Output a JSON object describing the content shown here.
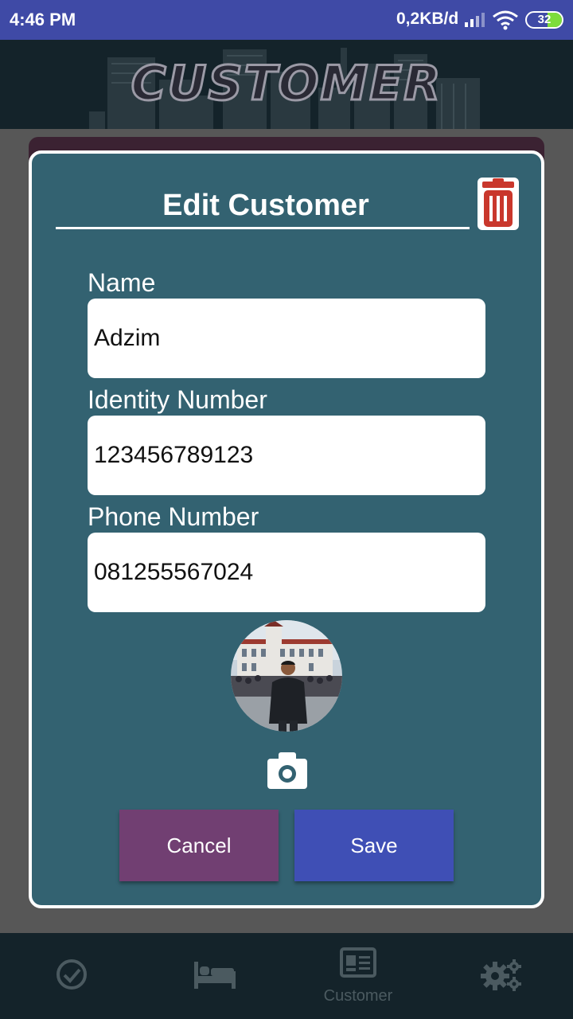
{
  "status_bar": {
    "time": "4:46 PM",
    "network_speed": "0,2KB/d",
    "battery_level": "32",
    "icons": [
      "signal-icon",
      "wifi-icon",
      "battery-icon"
    ]
  },
  "header": {
    "title": "CUSTOMER"
  },
  "dialog": {
    "title": "Edit Customer",
    "delete_icon": "trash-icon",
    "fields": {
      "name": {
        "label": "Name",
        "value": "Adzim"
      },
      "identity": {
        "label": "Identity Number",
        "value": "123456789123"
      },
      "phone": {
        "label": "Phone Number",
        "value": "081255567024"
      }
    },
    "photo_icon": "camera-icon",
    "buttons": {
      "cancel": "Cancel",
      "save": "Save"
    }
  },
  "bottom_nav": {
    "items": [
      {
        "icon": "check-circle-icon",
        "label": ""
      },
      {
        "icon": "bed-icon",
        "label": ""
      },
      {
        "icon": "id-card-icon",
        "label": "Customer"
      },
      {
        "icon": "gears-icon",
        "label": ""
      }
    ]
  },
  "colors": {
    "status_bar": "#3f4aa6",
    "dialog_bg": "#336271",
    "cancel": "#713f72",
    "save": "#3f4fb5",
    "trash": "#c9372c"
  }
}
